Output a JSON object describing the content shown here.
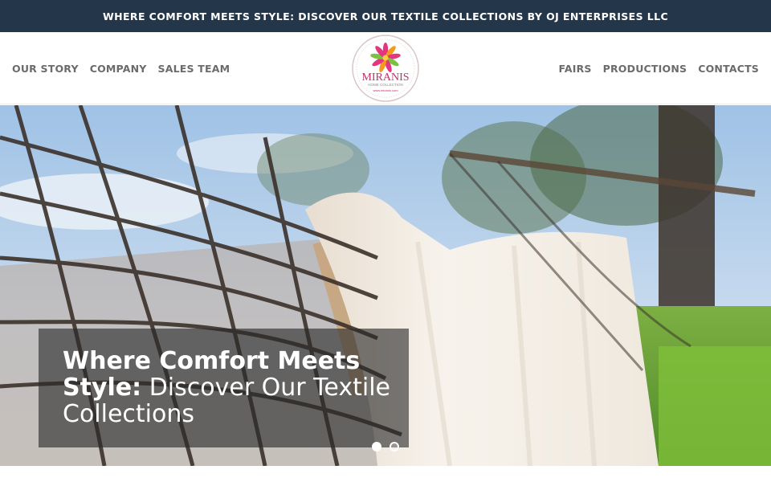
{
  "topbar": {
    "announcement": "WHERE COMFORT MEETS STYLE: DISCOVER OUR TEXTILE COLLECTIONS BY OJ ENTERPRISES LLC"
  },
  "nav": {
    "left": [
      "OUR STORY",
      "COMPANY",
      "SALES TEAM"
    ],
    "right": [
      "FAIRS",
      "PRODUCTIONS",
      "CONTACTS"
    ]
  },
  "logo": {
    "brand": "MIRANIS",
    "subtitle": "HOME COLLECTION",
    "url": "www.miranis.com",
    "ring_text": "HOME COLLECTION · HOME COLLECTION ·",
    "colors": {
      "petals_pink": "#e5357f",
      "petals_orange": "#f39a1e",
      "petals_green": "#7cc242",
      "brand_text": "#c0306a"
    }
  },
  "hero": {
    "image": "hammock-with-white-blanket",
    "caption_bold": "Where Comfort Meets Style:",
    "caption_light": "Discover Our Textile Collections",
    "slides": [
      {
        "label": "slide-1",
        "active": true
      },
      {
        "label": "slide-2",
        "active": false
      }
    ]
  },
  "colors": {
    "topbar_bg": "#23364a",
    "nav_text": "#6b6b6b",
    "caption_overlay": "rgba(40,40,40,0.62)"
  }
}
